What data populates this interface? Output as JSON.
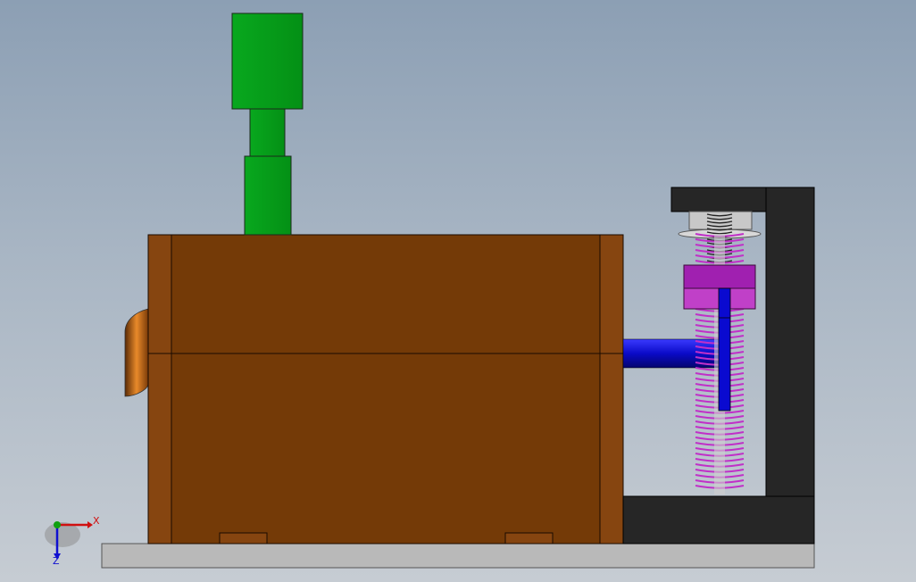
{
  "triad": {
    "x_label": "X",
    "z_label": "Z"
  },
  "colors": {
    "background_top": "#8c9fb4",
    "background_bottom": "#c6ccd3",
    "body": "#743a07",
    "body_edge": "#8a470d",
    "motor": "#06a01b",
    "shaft": "#0a0aa0",
    "bracket": "#262626",
    "base_plate": "#b9b9b9",
    "spring": "#b020b0",
    "nut": "#a020b0",
    "axis_x": "#d01010",
    "axis_y": "#10a010",
    "axis_z": "#1010d0"
  }
}
